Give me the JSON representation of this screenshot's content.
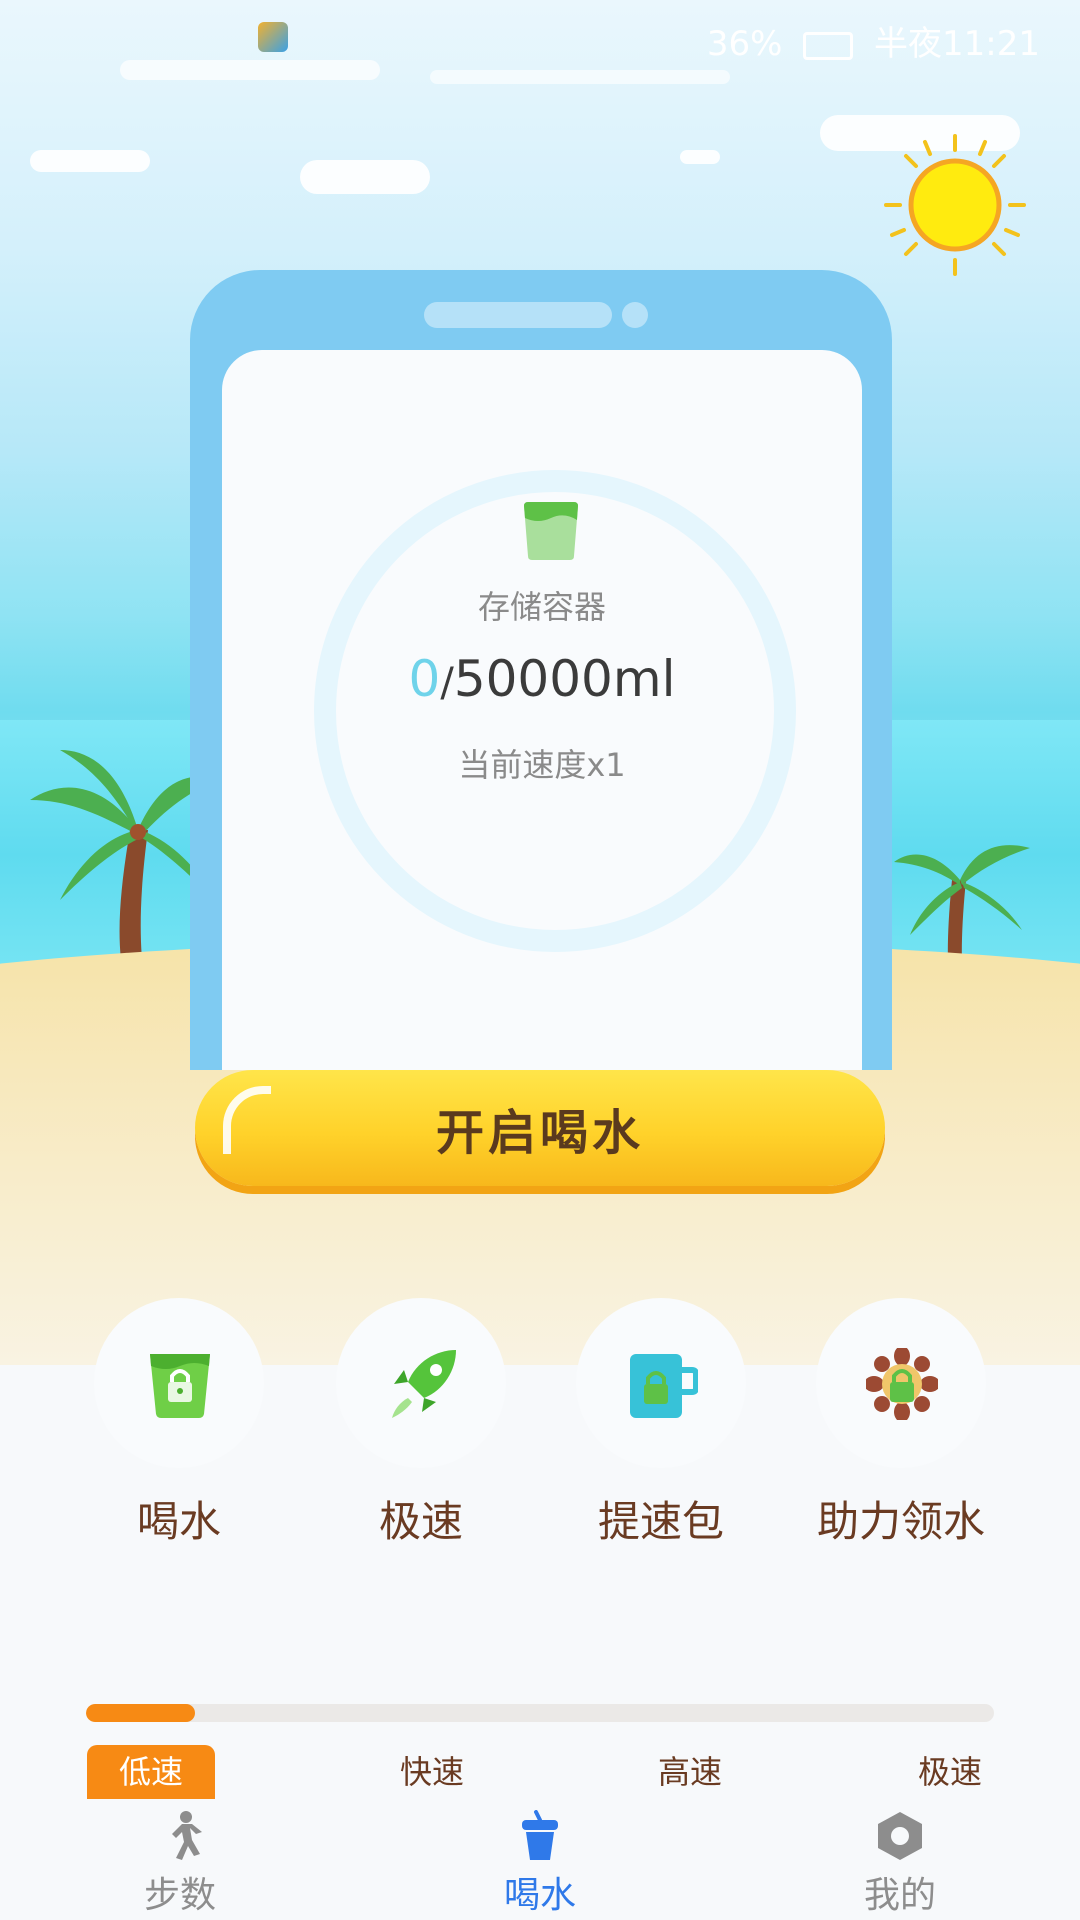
{
  "status_bar": {
    "left_text": "",
    "battery": "36%",
    "time": "半夜11:21"
  },
  "storage": {
    "label": "存储容器",
    "current": "0",
    "separator": "/",
    "capacity": "50000ml",
    "speed": "当前速度x1"
  },
  "start_button": "开启喝水",
  "features": [
    {
      "label": "喝水",
      "icon": "locked-cup-icon",
      "color": "#6fcf47"
    },
    {
      "label": "极速",
      "icon": "rocket-icon",
      "color": "#55c43b"
    },
    {
      "label": "提速包",
      "icon": "locked-mug-icon",
      "color": "#37c2d8"
    },
    {
      "label": "助力领水",
      "icon": "locked-flower-icon",
      "color": "#9c4a33"
    }
  ],
  "speed_progress": {
    "fraction": 0.12,
    "levels": [
      "低速",
      "快速",
      "高速",
      "极速"
    ],
    "active_index": 0
  },
  "bottom_nav": [
    {
      "label": "步数",
      "icon": "walking-icon"
    },
    {
      "label": "喝水",
      "icon": "cup-icon",
      "active": true
    },
    {
      "label": "我的",
      "icon": "profile-hexagon-icon"
    }
  ],
  "colors": {
    "accent_orange": "#f78a14",
    "active_blue": "#2f79e9",
    "button_yellow": "#ffd22a"
  }
}
